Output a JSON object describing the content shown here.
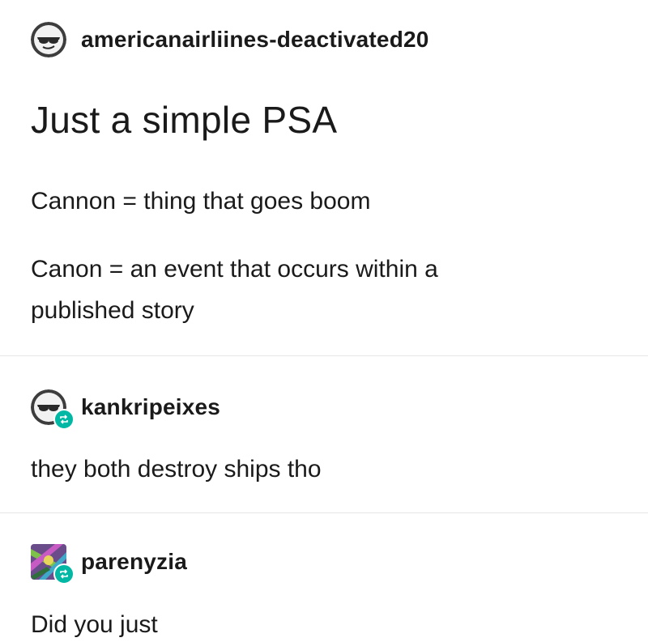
{
  "posts": [
    {
      "username": "americanairliines-deactivated20",
      "title": "Just a simple PSA",
      "lines": [
        "Cannon = thing that goes boom",
        "Canon = an event that occurs within a",
        "published story"
      ]
    },
    {
      "username": "kankripeixes",
      "lines": [
        "they both destroy ships tho"
      ],
      "reblog_icon": "reblog-icon"
    },
    {
      "username": "parenyzia",
      "lines": [
        "Did you just"
      ],
      "reblog_icon": "reblog-icon"
    }
  ],
  "colors": {
    "reblog_badge": "#00b8a4",
    "divider": "#e6e6e6",
    "text": "#1a1a1a"
  }
}
